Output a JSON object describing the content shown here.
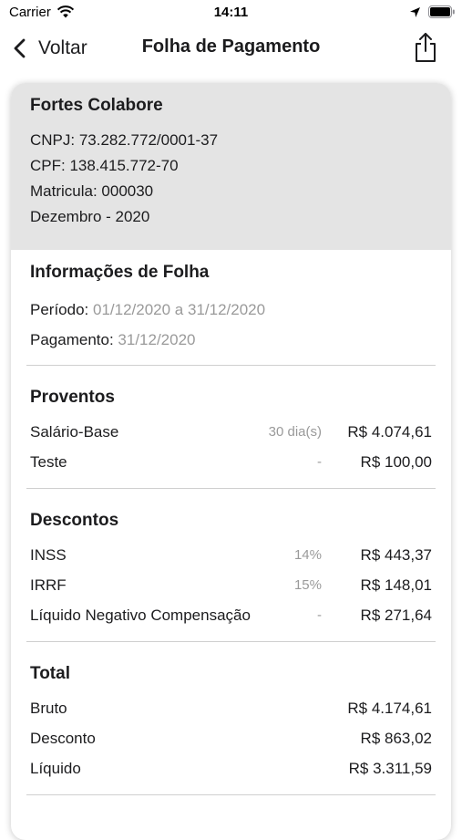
{
  "status_bar": {
    "carrier": "Carrier",
    "time": "14:11"
  },
  "nav": {
    "back_label": "Voltar",
    "title": "Folha de Pagamento"
  },
  "employee": {
    "name": "Fortes Colabore",
    "cnpj": "CNPJ: 73.282.772/0001-37",
    "cpf": "CPF: 138.415.772-70",
    "matricula": "Matricula: 000030",
    "competencia": "Dezembro - 2020"
  },
  "folha": {
    "title": "Informações de Folha",
    "periodo_label": "Período:",
    "periodo_value": "01/12/2020 a 31/12/2020",
    "pagamento_label": "Pagamento:",
    "pagamento_value": "31/12/2020"
  },
  "proventos": {
    "title": "Proventos",
    "rows": [
      {
        "label": "Salário-Base",
        "ref": "30 dia(s)",
        "value": "R$ 4.074,61"
      },
      {
        "label": "Teste",
        "ref": "-",
        "value": "R$ 100,00"
      }
    ]
  },
  "descontos": {
    "title": "Descontos",
    "rows": [
      {
        "label": "INSS",
        "ref": "14%",
        "value": "R$ 443,37"
      },
      {
        "label": "IRRF",
        "ref": "15%",
        "value": "R$ 148,01"
      },
      {
        "label": "Líquido Negativo Compensação",
        "ref": "-",
        "value": "R$ 271,64"
      }
    ]
  },
  "total": {
    "title": "Total",
    "rows": [
      {
        "label": "Bruto",
        "value": "R$ 4.174,61"
      },
      {
        "label": "Desconto",
        "value": "R$ 863,02"
      },
      {
        "label": "Líquido",
        "value": "R$ 3.311,59"
      }
    ]
  },
  "colors": {
    "header_bg": "#e4e4e4",
    "muted_text": "#9a9a9a",
    "divider": "#cfcfcf"
  }
}
